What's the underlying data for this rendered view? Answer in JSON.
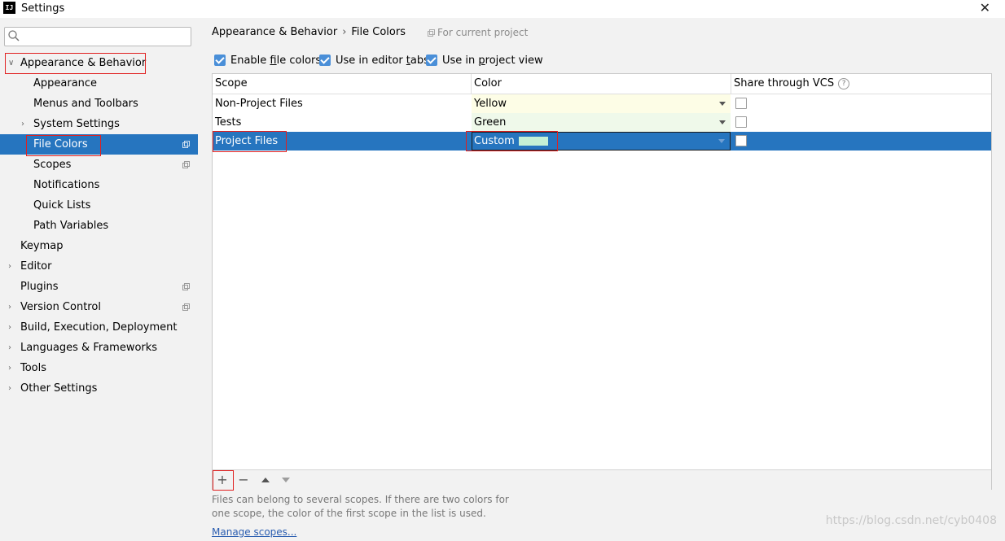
{
  "window": {
    "title": "Settings",
    "logo_text": "IJ",
    "close_glyph": "✕"
  },
  "sidebar": {
    "search": {
      "value": "",
      "placeholder": ""
    },
    "items": [
      {
        "label": "Appearance & Behavior",
        "expanded": true,
        "arrow": "∨"
      },
      {
        "label": "Appearance"
      },
      {
        "label": "Menus and Toolbars"
      },
      {
        "label": "System Settings",
        "arrow": "›"
      },
      {
        "label": "File Colors",
        "selected": true,
        "project_icon": "copy-icon"
      },
      {
        "label": "Scopes",
        "project_icon": "copy-icon"
      },
      {
        "label": "Notifications"
      },
      {
        "label": "Quick Lists"
      },
      {
        "label": "Path Variables"
      },
      {
        "label": "Keymap"
      },
      {
        "label": "Editor",
        "arrow": "›"
      },
      {
        "label": "Plugins",
        "project_icon": "copy-icon"
      },
      {
        "label": "Version Control",
        "arrow": "›",
        "project_icon": "copy-icon"
      },
      {
        "label": "Build, Execution, Deployment",
        "arrow": "›"
      },
      {
        "label": "Languages & Frameworks",
        "arrow": "›"
      },
      {
        "label": "Tools",
        "arrow": "›"
      },
      {
        "label": "Other Settings",
        "arrow": "›"
      }
    ]
  },
  "breadcrumb": {
    "parent": "Appearance & Behavior",
    "separator": "›",
    "current": "File Colors"
  },
  "scope_note": "For current project",
  "options": [
    {
      "pre": "Enable ",
      "mnemonic": "f",
      "post": "ile colors",
      "checked": true
    },
    {
      "pre": "Use in editor ",
      "mnemonic": "t",
      "post": "abs",
      "checked": true
    },
    {
      "pre": "Use in ",
      "mnemonic": "p",
      "post": "roject view",
      "checked": true
    }
  ],
  "table": {
    "columns": {
      "scope": "Scope",
      "color": "Color",
      "share": "Share through VCS"
    },
    "help_glyph": "?",
    "rows": [
      {
        "scope": "Non-Project Files",
        "color": "Yellow",
        "color_hex": "#fdfde6",
        "share": false
      },
      {
        "scope": "Tests",
        "color": "Green",
        "color_hex": "#eff9ea",
        "share": false
      },
      {
        "scope": "Project Files",
        "color": "Custom",
        "swatch_hex": "#c5f1d5",
        "share": false,
        "selected": true
      }
    ]
  },
  "toolbar": {
    "add": "+",
    "remove": "−"
  },
  "hint": "Files can belong to several scopes. If there are two colors for one scope, the color of the first scope in the list is used.",
  "manage_link": "Manage scopes...",
  "watermark": "https://blog.csdn.net/cyb0408",
  "colors": {
    "selection": "#2675bf",
    "highlight_box": "#e02020",
    "checkbox": "#4a8fd8"
  }
}
